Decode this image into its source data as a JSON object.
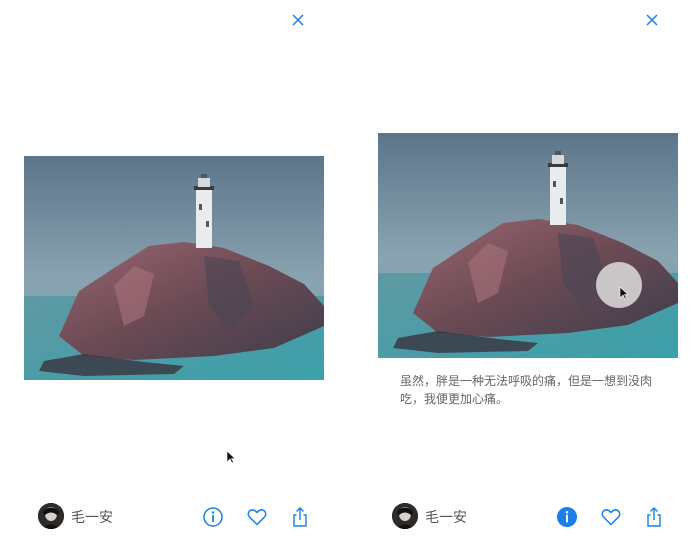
{
  "colors": {
    "accent": "#1a7fe8"
  },
  "panels": [
    {
      "close_icon": "close-icon",
      "author": "毛一安",
      "caption": "",
      "info_icon": "info-outline-icon"
    },
    {
      "close_icon": "close-icon",
      "author": "毛一安",
      "caption": "虽然，胖是一种无法呼吸的痛，但是一想到没肉吃，我便更加心痛。",
      "info_icon": "info-filled-icon"
    }
  ]
}
